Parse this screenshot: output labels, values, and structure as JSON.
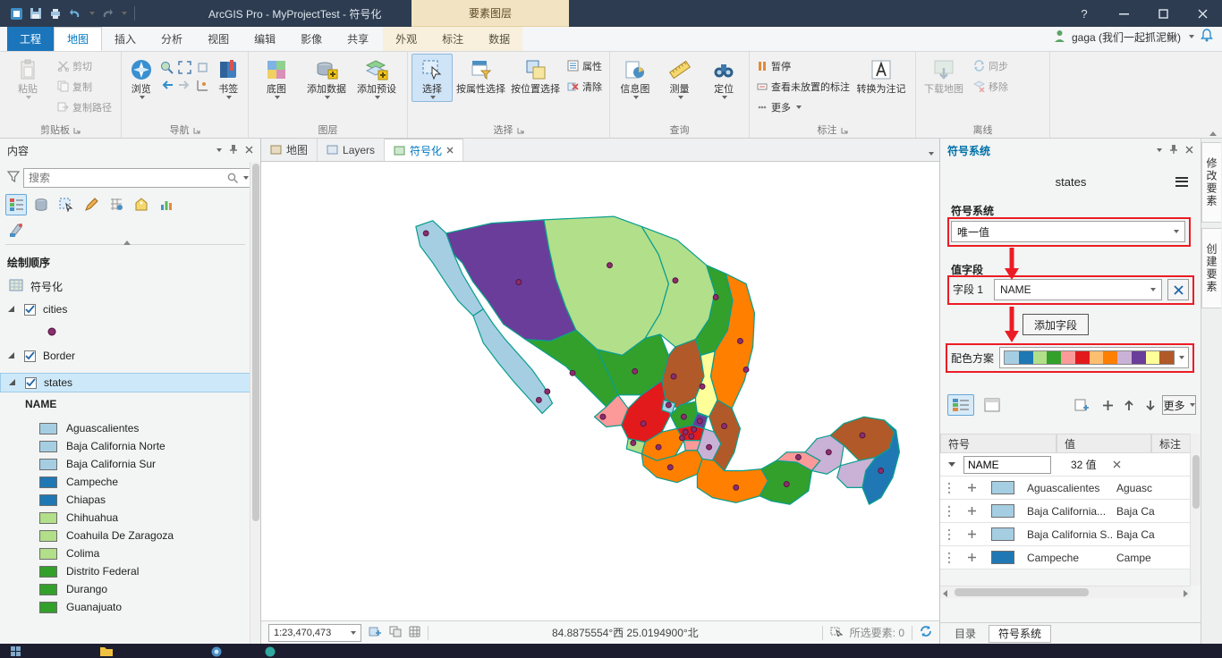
{
  "window": {
    "title": "ArcGIS Pro - MyProjectTest - 符号化",
    "contextual_group": "要素图层",
    "account": "gaga (我们一起抓泥鳅)",
    "controls": {
      "help": "?"
    }
  },
  "tabs": {
    "backstage": "工程",
    "items": [
      "地图",
      "插入",
      "分析",
      "视图",
      "编辑",
      "影像",
      "共享"
    ],
    "contextual": [
      "外观",
      "标注",
      "数据"
    ]
  },
  "ribbon": {
    "clipboard": {
      "label": "剪贴板",
      "paste": "粘贴",
      "cut": "剪切",
      "copy": "复制",
      "copy_path": "复制路径"
    },
    "navigate": {
      "label": "导航",
      "explore": "浏览",
      "bookmarks": "书签"
    },
    "layer": {
      "label": "图层",
      "basemap": "底图",
      "add_data": "添加数据",
      "add_preset": "添加预设"
    },
    "selection": {
      "label": "选择",
      "select": "选择",
      "by_attributes": "按属性选择",
      "by_location": "按位置选择",
      "attributes": "属性",
      "clear": "清除"
    },
    "inquiry": {
      "label": "查询",
      "infographics": "信息图",
      "measure": "测量",
      "locate": "定位"
    },
    "labeling": {
      "label": "标注",
      "pause": "暂停",
      "view_unplaced": "查看未放置的标注",
      "more": "更多",
      "convert": "转换为注记"
    },
    "offline": {
      "label": "离线",
      "download": "下载地图",
      "sync": "同步",
      "remove": "移除"
    }
  },
  "contents": {
    "title": "内容",
    "search_placeholder": "搜索",
    "drawing_order": "绘制顺序",
    "map_item": "符号化",
    "layers": [
      {
        "name": "cities"
      },
      {
        "name": "Border"
      },
      {
        "name": "states"
      }
    ],
    "field": "NAME",
    "legend": [
      {
        "label": "Aguascalientes",
        "color": "#a6cee3"
      },
      {
        "label": "Baja California Norte",
        "color": "#a6cee3"
      },
      {
        "label": "Baja California Sur",
        "color": "#a6cee3"
      },
      {
        "label": "Campeche",
        "color": "#1f78b4"
      },
      {
        "label": "Chiapas",
        "color": "#1f78b4"
      },
      {
        "label": "Chihuahua",
        "color": "#b2df8a"
      },
      {
        "label": "Coahuila De Zaragoza",
        "color": "#b2df8a"
      },
      {
        "label": "Colima",
        "color": "#b2df8a"
      },
      {
        "label": "Distrito Federal",
        "color": "#33a02c"
      },
      {
        "label": "Durango",
        "color": "#33a02c"
      },
      {
        "label": "Guanajuato",
        "color": "#33a02c"
      }
    ]
  },
  "map": {
    "tabs": [
      "地图",
      "Layers",
      "符号化"
    ],
    "active_tab": "符号化",
    "scale": "1:23,470,473",
    "coordinates": "84.8875554°西 25.0194900°北",
    "selected": "所选要素: 0"
  },
  "symbology": {
    "panel_title": "符号系统",
    "layer": "states",
    "method_label": "符号系统",
    "method": "唯一值",
    "value_field_label": "值字段",
    "field1_label": "字段 1",
    "field1_value": "NAME",
    "add_field": "添加字段",
    "color_scheme_label": "配色方案",
    "more": "更多",
    "scheme_colors": [
      "#a6cee3",
      "#1f78b4",
      "#b2df8a",
      "#33a02c",
      "#fb9a99",
      "#e31a1c",
      "#fdbf6f",
      "#ff7f00",
      "#cab2d6",
      "#6a3d9a",
      "#ffff99",
      "#b15928"
    ],
    "table": {
      "headers": [
        "符号",
        "值",
        "标注"
      ],
      "group_field": "NAME",
      "count": "32 值",
      "rows": [
        {
          "color": "#a6cee3",
          "value": "Aguascalientes",
          "note": "Aguasc"
        },
        {
          "color": "#a6cee3",
          "value": "Baja California...",
          "note": "Baja Ca"
        },
        {
          "color": "#a6cee3",
          "value": "Baja California S...",
          "note": "Baja Ca"
        },
        {
          "color": "#1f78b4",
          "value": "Campeche",
          "note": "Campe"
        }
      ]
    },
    "bottom_tabs": [
      "目录",
      "符号系统"
    ]
  },
  "edge_tabs": [
    "修改要素",
    "创建要素"
  ]
}
